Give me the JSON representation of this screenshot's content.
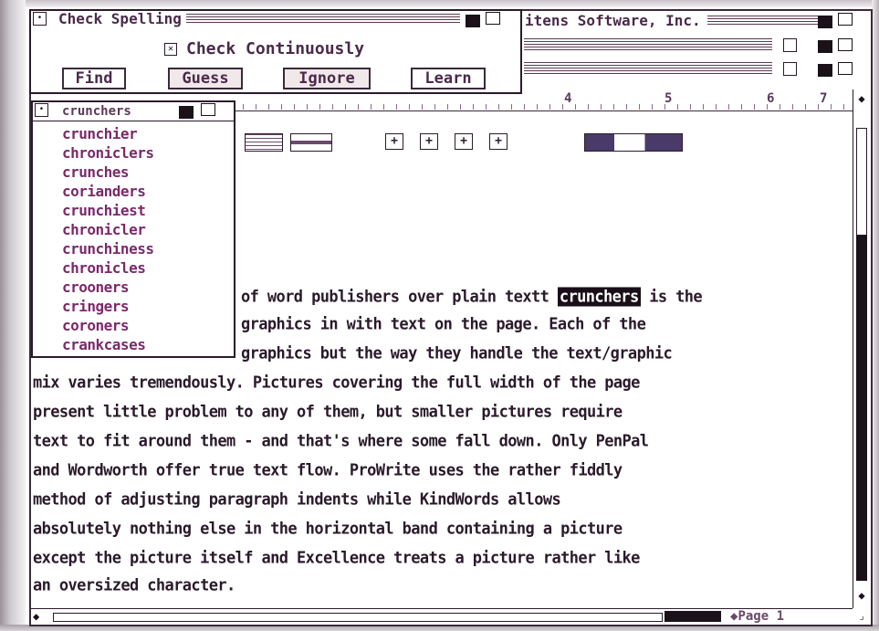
{
  "spelling_window": {
    "title": "Check Spelling",
    "check_continuously_label": "Check Continuously",
    "check_continuously_mark": "✕",
    "buttons": {
      "find": "Find",
      "guess": "Guess",
      "ignore": "Ignore",
      "learn": "Learn"
    }
  },
  "document_window": {
    "title_fragment": "itens Software, Inc.",
    "ruler_numbers": [
      "4",
      "5",
      "6",
      "7"
    ],
    "page_label": "Page 1",
    "body_lines": [
      {
        "before": "of word publishers over plain textt ",
        "highlight": "crunchers",
        "after": " is the"
      },
      {
        "before": "graphics in with text on the page. Each of the",
        "highlight": "",
        "after": ""
      },
      {
        "before": "graphics but the way they handle the text/graphic",
        "highlight": "",
        "after": ""
      },
      {
        "before": "mix varies tremendously. Pictures covering the full width of the page",
        "highlight": "",
        "after": ""
      },
      {
        "before": "present little problem to any of them, but smaller pictures require",
        "highlight": "",
        "after": ""
      },
      {
        "before": "text to fit around them - and that's where some fall down. Only PenPal",
        "highlight": "",
        "after": ""
      },
      {
        "before": "and Wordworth offer true text flow. ProWrite uses the rather fiddly",
        "highlight": "",
        "after": ""
      },
      {
        "before": "method of adjusting paragraph indents while KindWords allows",
        "highlight": "",
        "after": ""
      },
      {
        "before": "absolutely nothing else in the horizontal band containing a picture",
        "highlight": "",
        "after": ""
      },
      {
        "before": "except the picture itself and Excellence treats a picture rather like",
        "highlight": "",
        "after": ""
      },
      {
        "before": "an oversized character.",
        "highlight": "",
        "after": ""
      }
    ]
  },
  "suggestions_window": {
    "title": "crunchers",
    "items": [
      "crunchier",
      "chroniclers",
      "crunches",
      "corianders",
      "crunchiest",
      "chronicler",
      "crunchiness",
      "chronicles",
      "crooners",
      "cringers",
      "coroners",
      "crankcases"
    ]
  },
  "colors": {
    "text": "#2a1a2a",
    "accent_purple": "#7a2a6a",
    "highlight_bg": "#1a0e18"
  }
}
